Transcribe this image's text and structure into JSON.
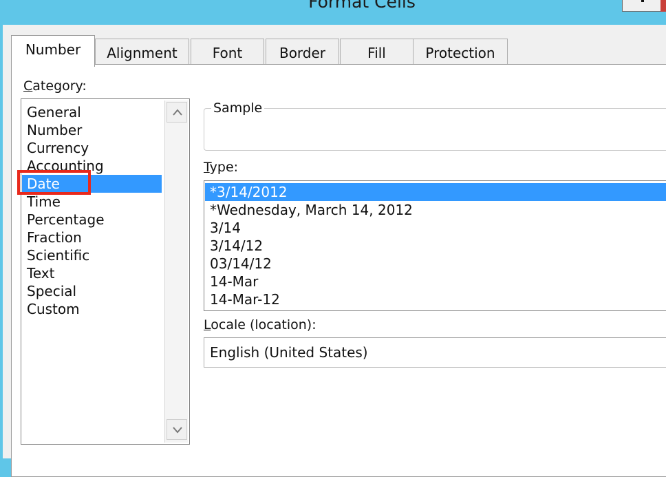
{
  "window": {
    "title": "Format Cells"
  },
  "tabs": [
    {
      "label": "Number",
      "active": true
    },
    {
      "label": "Alignment",
      "active": false
    },
    {
      "label": "Font",
      "active": false
    },
    {
      "label": "Border",
      "active": false
    },
    {
      "label": "Fill",
      "active": false
    },
    {
      "label": "Protection",
      "active": false
    }
  ],
  "category": {
    "label_first": "C",
    "label_rest": "ategory:",
    "items": [
      "General",
      "Number",
      "Currency",
      "Accounting",
      "Date",
      "Time",
      "Percentage",
      "Fraction",
      "Scientific",
      "Text",
      "Special",
      "Custom"
    ],
    "selected": "Date"
  },
  "sample": {
    "label": "Sample"
  },
  "type": {
    "label_first": "T",
    "label_rest": "ype:",
    "items": [
      "*3/14/2012",
      "*Wednesday, March 14, 2012",
      "3/14",
      "3/14/12",
      "03/14/12",
      "14-Mar",
      "14-Mar-12"
    ],
    "selected": "*3/14/2012"
  },
  "locale": {
    "label_first": "L",
    "label_rest": "ocale (location):",
    "value": "English (United States)"
  },
  "colors": {
    "titlebar": "#5fc6e8",
    "selection": "#3399ff",
    "highlight": "#e8291c"
  }
}
